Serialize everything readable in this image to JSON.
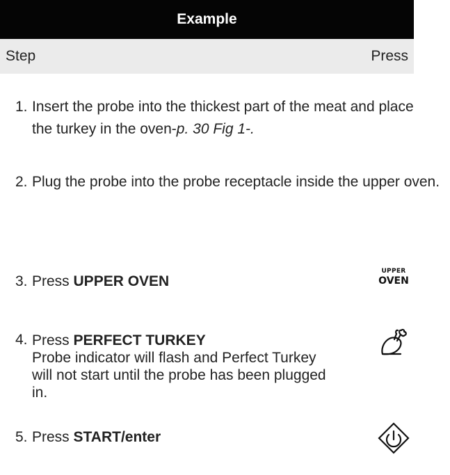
{
  "header": {
    "title": "Example"
  },
  "subheader": {
    "left": "Step",
    "right": "Press"
  },
  "steps": [
    {
      "num": "1.",
      "text_a": "Insert the probe into the thickest part of the meat and place the turkey in the oven-",
      "text_italic": "p. 30 Fig 1-."
    },
    {
      "num": "2.",
      "text": "Plug the probe into the probe receptacle inside the upper oven."
    },
    {
      "num": "3.",
      "prefix": "Press ",
      "bold": "UPPER OVEN"
    },
    {
      "num": "4.",
      "prefix": "Press ",
      "bold": "PERFECT TURKEY",
      "detail": "Probe indicator will flash and Perfect Turkey will not start until the probe has been plugged in."
    },
    {
      "num": "5.",
      "prefix": "Press ",
      "bold": "START/enter"
    }
  ],
  "buttons": {
    "upper_oven": {
      "line1": "UPPER",
      "line2": "OVEN",
      "icon": "upper-oven-key-icon"
    },
    "perfect_turkey": {
      "icon": "turkey-icon"
    },
    "start": {
      "icon": "start-diamond-icon"
    }
  }
}
